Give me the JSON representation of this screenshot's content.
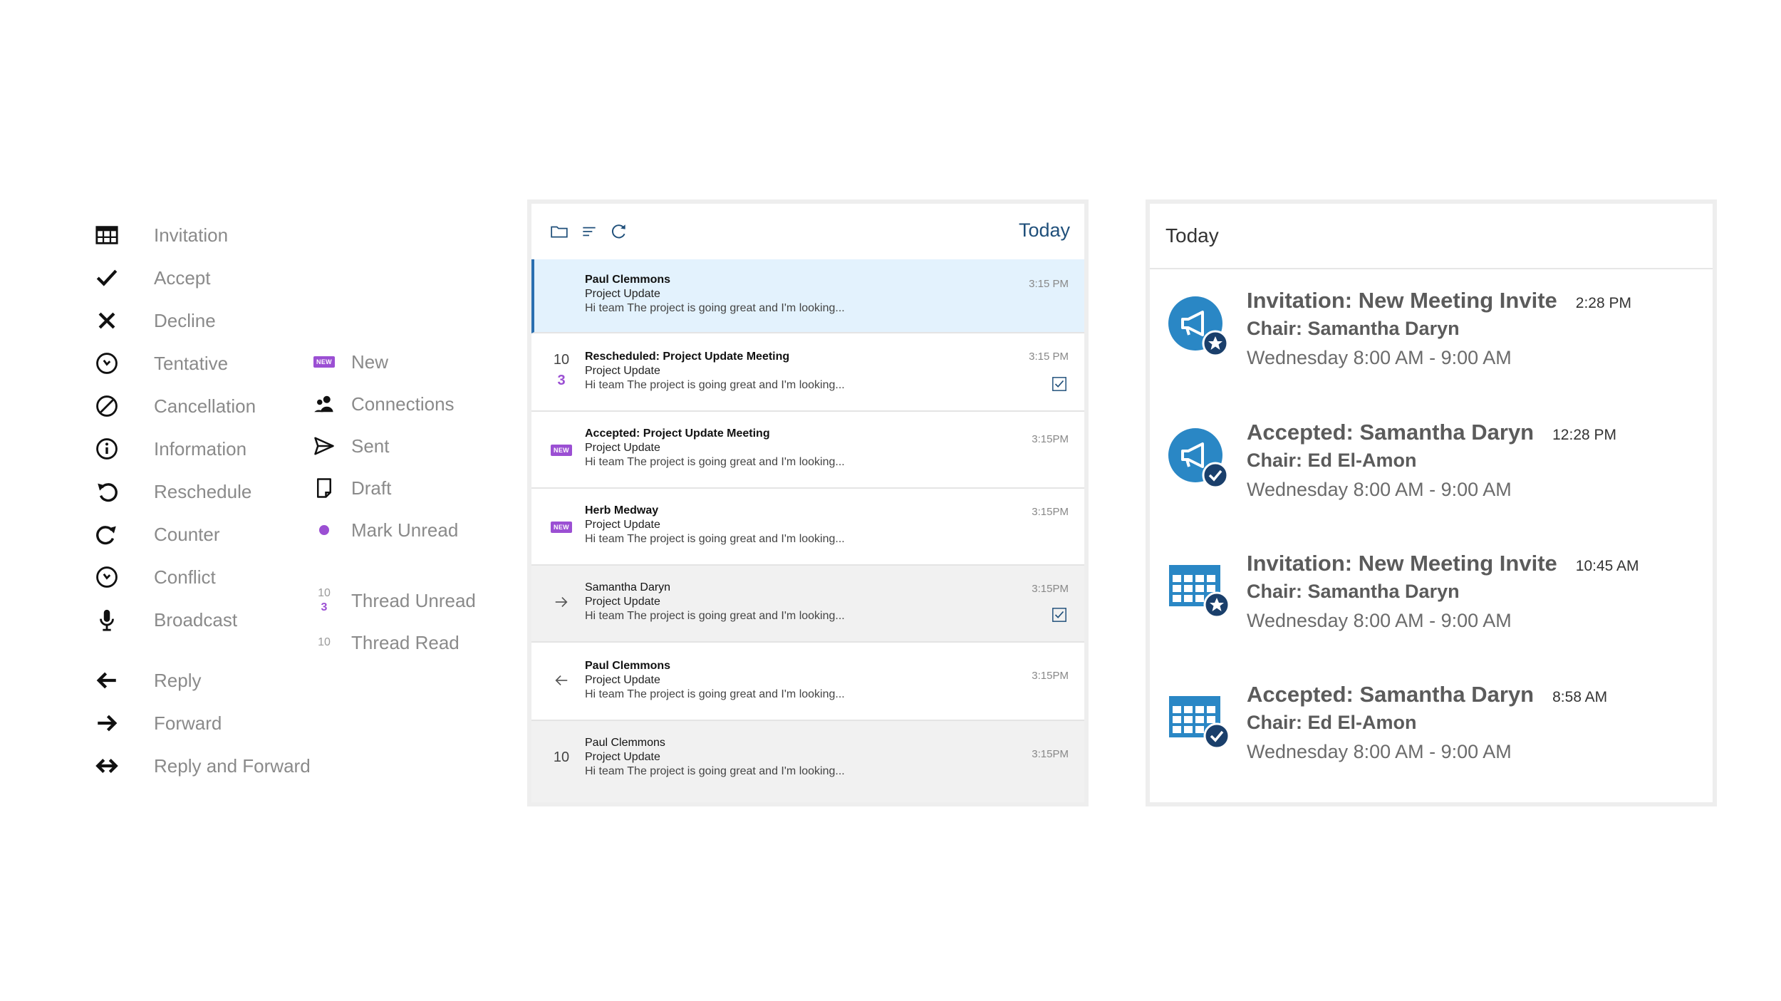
{
  "legend": {
    "items": [
      {
        "label": "Invitation",
        "icon": "calendar-grid-icon"
      },
      {
        "label": "Accept",
        "icon": "checkmark-icon"
      },
      {
        "label": "Decline",
        "icon": "x-icon"
      },
      {
        "label": "Tentative",
        "icon": "clock-icon"
      },
      {
        "label": "Cancellation",
        "icon": "prohibited-icon"
      },
      {
        "label": "Information",
        "icon": "info-icon"
      },
      {
        "label": "Reschedule",
        "icon": "rotate-ccw-icon"
      },
      {
        "label": "Counter",
        "icon": "rotate-cw-icon"
      },
      {
        "label": "Conflict",
        "icon": "clock-icon"
      },
      {
        "label": "Broadcast",
        "icon": "microphone-icon"
      },
      {
        "label": "Reply",
        "icon": "arrow-left-icon"
      },
      {
        "label": "Forward",
        "icon": "arrow-right-icon"
      },
      {
        "label": "Reply and Forward",
        "icon": "arrow-both-icon"
      }
    ],
    "status_items": [
      {
        "label": "New",
        "icon": "new-badge-icon",
        "badge": "NEW"
      },
      {
        "label": "Connections",
        "icon": "people-icon"
      },
      {
        "label": "Sent",
        "icon": "paper-plane-icon"
      },
      {
        "label": "Draft",
        "icon": "draft-page-icon"
      },
      {
        "label": "Mark Unread",
        "icon": "unread-dot-icon"
      },
      {
        "label": "Thread Unread",
        "icon": "thread-count-icon",
        "count": "10",
        "unread": "3"
      },
      {
        "label": "Thread Read",
        "icon": "thread-count-icon",
        "count": "10"
      }
    ]
  },
  "mail": {
    "toolbar_title": "Today",
    "badge": "NEW",
    "rows": [
      {
        "from": "Paul Clemmons",
        "subject": "Project Update",
        "preview": "Hi team The project is going great and I'm looking...",
        "time": "3:15 PM"
      },
      {
        "from": "Rescheduled: Project Update Meeting",
        "subject": "Project Update",
        "preview": "Hi team The project is going great and I'm looking...",
        "time": "3:15 PM",
        "count": "10",
        "unread": "3"
      },
      {
        "from": "Accepted: Project Update Meeting",
        "subject": "Project Update",
        "preview": "Hi team The project is going great and I'm looking...",
        "time": "3:15PM"
      },
      {
        "from": "Herb Medway",
        "subject": "Project Update",
        "preview": "Hi team The project is going great and I'm looking...",
        "time": "3:15PM"
      },
      {
        "from": "Samantha Daryn",
        "subject": "Project Update",
        "preview": "Hi team The project is going great and I'm looking...",
        "time": "3:15PM"
      },
      {
        "from": "Paul Clemmons",
        "subject": "Project Update",
        "preview": "Hi team The project is going great and I'm looking...",
        "time": "3:15PM"
      },
      {
        "from": "Paul Clemmons",
        "subject": "Project Update",
        "preview": "Hi team The project is going great and I'm looking...",
        "time": "3:15PM",
        "count": "10"
      }
    ]
  },
  "calendar": {
    "title": "Today",
    "items": [
      {
        "title": "Invitation: New Meeting Invite",
        "time": "2:28 PM",
        "chair": "Chair: Samantha Daryn",
        "when": "Wednesday 8:00 AM - 9:00 AM",
        "icon": "broadcast-star-icon"
      },
      {
        "title": "Accepted: Samantha Daryn",
        "time": "12:28 PM",
        "chair": "Chair: Ed El-Amon",
        "when": "Wednesday 8:00 AM - 9:00 AM",
        "icon": "broadcast-check-icon"
      },
      {
        "title": "Invitation: New Meeting Invite",
        "time": "10:45 AM",
        "chair": "Chair: Samantha Daryn",
        "when": "Wednesday 8:00 AM - 9:00 AM",
        "icon": "calendar-star-icon"
      },
      {
        "title": "Accepted: Samantha Daryn",
        "time": "8:58 AM",
        "chair": "Chair: Ed El-Amon",
        "when": "Wednesday 8:00 AM - 9:00 AM",
        "icon": "calendar-check-icon"
      }
    ]
  },
  "colors": {
    "accent_purple": "#9b4fd3",
    "accent_blue": "#2a87c5",
    "navy": "#1f4f7a"
  }
}
